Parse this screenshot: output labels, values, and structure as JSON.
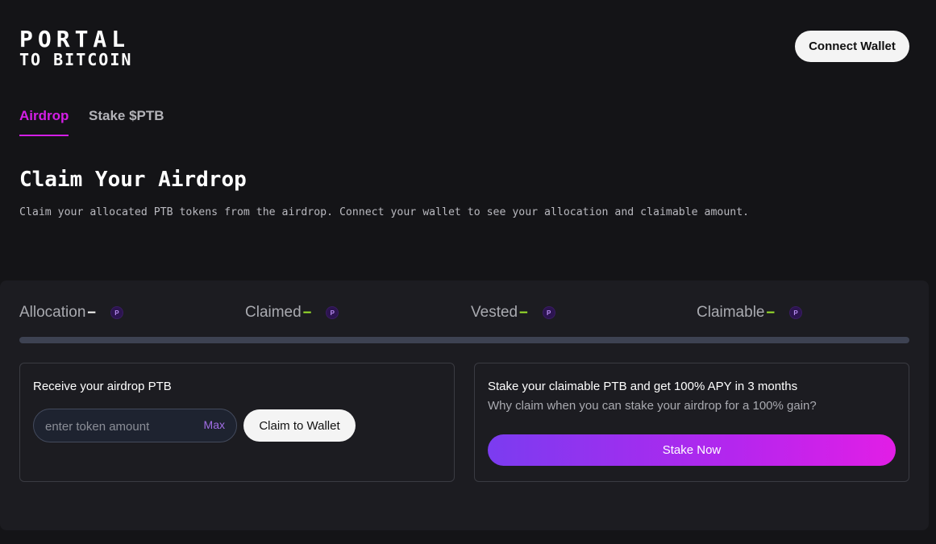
{
  "brand": {
    "line1": "PORTAL",
    "line2": "TO BITCOIN",
    "accent": "#8c2cf0"
  },
  "header": {
    "connect_label": "Connect Wallet"
  },
  "tabs": [
    {
      "label": "Airdrop",
      "active": true
    },
    {
      "label": "Stake $PTB",
      "active": false
    }
  ],
  "page": {
    "title": "Claim Your Airdrop",
    "subtitle": "Claim your allocated PTB tokens from the airdrop. Connect your wallet to see your allocation and claimable amount."
  },
  "stats": [
    {
      "label": "Allocation",
      "value": "–",
      "dash_color": "#ffffff",
      "icon": "ptb-token-icon",
      "coin_glyph": "P"
    },
    {
      "label": "Claimed",
      "value": "–",
      "dash_color": "#9ee82c",
      "icon": "ptb-token-icon",
      "coin_glyph": "P"
    },
    {
      "label": "Vested",
      "value": "–",
      "dash_color": "#9ee82c",
      "icon": "ptb-token-icon",
      "coin_glyph": "P"
    },
    {
      "label": "Claimable",
      "value": "–",
      "dash_color": "#9ee82c",
      "icon": "ptb-token-icon",
      "coin_glyph": "P"
    }
  ],
  "progress": {
    "value": 0
  },
  "receive_card": {
    "title": "Receive your airdrop PTB",
    "input_value": "",
    "input_placeholder": "enter token amount",
    "max_label": "Max",
    "claim_label": "Claim to Wallet"
  },
  "stake_card": {
    "title": "Stake your claimable PTB and get 100% APY in 3 months",
    "subtitle": "Why claim when you can stake your airdrop for a 100% gain?",
    "button_label": "Stake Now"
  },
  "colors": {
    "background": "#141417",
    "panel": "#1c1c21",
    "active_tab": "#d41ee6",
    "gradient_start": "#7b3cf0",
    "gradient_end": "#e21ee6"
  }
}
